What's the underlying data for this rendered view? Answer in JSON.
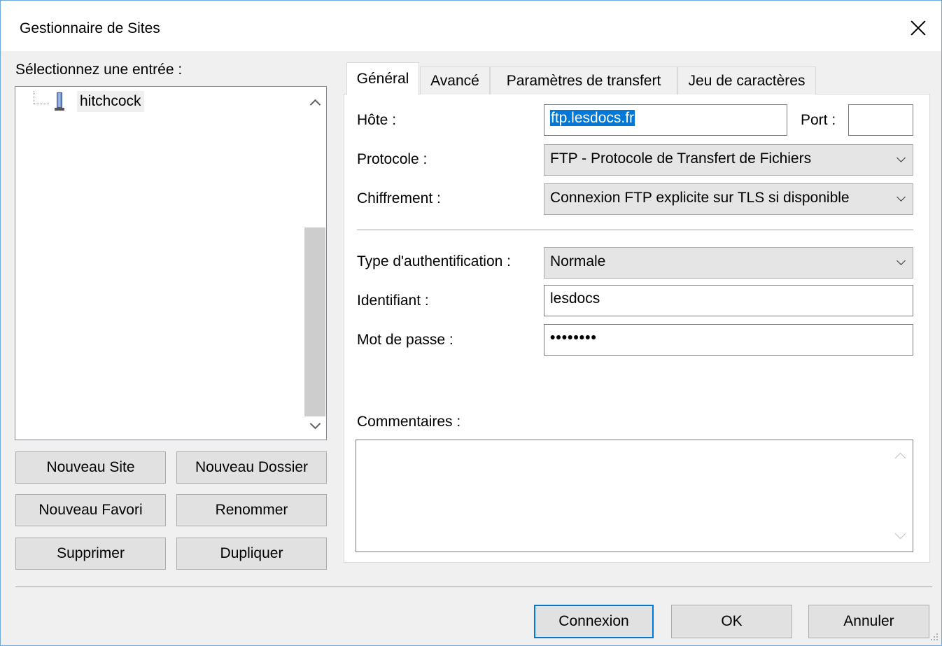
{
  "window": {
    "title": "Gestionnaire de Sites"
  },
  "left": {
    "select_label": "Sélectionnez une entrée :",
    "tree": [
      {
        "label": "hitchcock",
        "icon": "server-icon"
      }
    ],
    "buttons": {
      "new_site": "Nouveau Site",
      "new_folder": "Nouveau Dossier",
      "new_bookmark": "Nouveau Favori",
      "rename": "Renommer",
      "delete": "Supprimer",
      "duplicate": "Dupliquer"
    }
  },
  "tabs": [
    {
      "label": "Général",
      "active": true
    },
    {
      "label": "Avancé",
      "active": false
    },
    {
      "label": "Paramètres de transfert",
      "active": false
    },
    {
      "label": "Jeu de caractères",
      "active": false
    }
  ],
  "general": {
    "host_label": "Hôte :",
    "host_value": "ftp.lesdocs.fr",
    "port_label": "Port :",
    "port_value": "",
    "protocol_label": "Protocole :",
    "protocol_value": "FTP - Protocole de Transfert de Fichiers",
    "encryption_label": "Chiffrement :",
    "encryption_value": "Connexion FTP explicite sur TLS si disponible",
    "auth_label": "Type d'authentification :",
    "auth_value": "Normale",
    "user_label": "Identifiant :",
    "user_value": "lesdocs",
    "password_label": "Mot de passe :",
    "password_value": "••••••••",
    "comments_label": "Commentaires :",
    "comments_value": ""
  },
  "footer": {
    "connect": "Connexion",
    "ok": "OK",
    "cancel": "Annuler"
  },
  "colors": {
    "selection": "#0078d7",
    "accent_border": "#0078d7"
  }
}
